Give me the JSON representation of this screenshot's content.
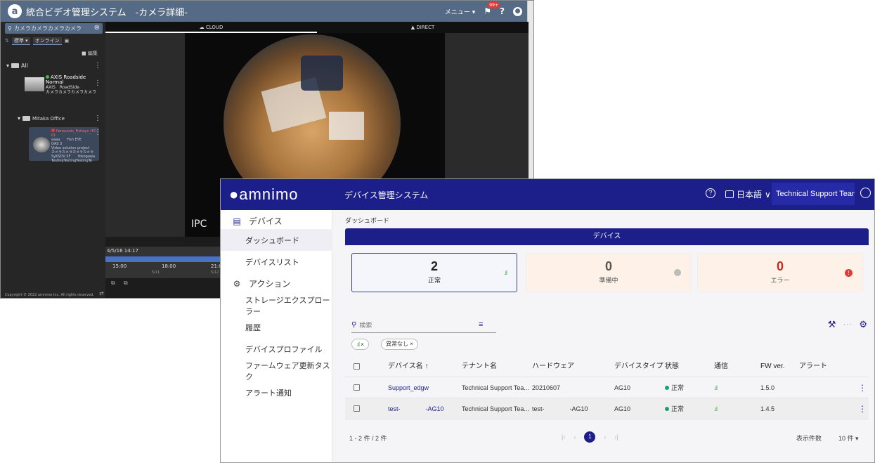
{
  "vms": {
    "title": "統合ビデオ管理システム　-カメラ詳細-",
    "menu_label": "メニュー ▾",
    "badge": "99+",
    "search_placeholder": "カメラカメラカメラカメラ",
    "filter_sort": "標準",
    "filter_online": "オンライン",
    "edit_label": "編集",
    "folder_all": "All",
    "camera1": {
      "name": "AXIS Roadside Normal",
      "maker": "AXIS",
      "model": "RoadSide",
      "desc": "カメラカメラカメラカメラ"
    },
    "folder_office": "Mitaka Office",
    "camera2": {
      "name": "Panasonic_Fisheye_IPC-01",
      "line1": "aaaa　　Fish EYE",
      "line2": "OAS 3",
      "line3": "Video solution project",
      "line4": "カメラカメラカメラカメラ",
      "line5": "SyKSDV 5F　　Yokogawa",
      "line6": "TestingTestingTestingTe"
    },
    "copyright": "Copyright © 2022 amnimo Inc. All rights reserved.",
    "tabs": [
      "CLOUD",
      "DIRECT"
    ],
    "overlay": "IPC",
    "timeline": {
      "date": "4/5/16 14:17",
      "t1": "15:00",
      "t2": "18:00",
      "t3": "21:0",
      "d1": "5/11",
      "d2": "5/12"
    },
    "colors": {
      "header": "#556b85"
    }
  },
  "dm": {
    "brand": "amnimo",
    "system": "デバイス管理システム",
    "language": "日本語",
    "team": "Technical Support Team ...",
    "nav": {
      "devices": "デバイス",
      "dashboard": "ダッシュボード",
      "device_list": "デバイスリスト",
      "actions": "アクション",
      "storage": "ストレージエクスプローラー",
      "history": "履歴",
      "profile": "デバイスプロファイル",
      "firmware": "ファームウェア更新タスク",
      "alert": "アラート通知"
    },
    "breadcrumb": "ダッシュボード",
    "panel_title": "デバイス",
    "cards": {
      "ok": {
        "count": "2",
        "label": "正常"
      },
      "prep": {
        "count": "0",
        "label": "準備中"
      },
      "err": {
        "count": "0",
        "label": "エラー"
      }
    },
    "search_placeholder": "検索",
    "chips": {
      "c1": "×",
      "c2": "異常なし ×"
    },
    "columns": {
      "name": "デバイス名 ↑",
      "tenant": "テナント名",
      "hw": "ハードウェア",
      "type": "デバイスタイプ",
      "state": "状態",
      "comm": "通信",
      "fw": "FW ver.",
      "alert": "アラート"
    },
    "rows": [
      {
        "name": "Support_edgw",
        "tenant": "Technical Support Tea...",
        "hw": "20210607",
        "type": "AG10",
        "state": "正常",
        "fw": "1.5.0"
      },
      {
        "name": "test-　　　　-AG10",
        "tenant": "Technical Support Tea...",
        "hw": "test-　　　　-AG10",
        "type": "AG10",
        "state": "正常",
        "fw": "1.4.5"
      }
    ],
    "footer": {
      "count": "1 - 2 件 / 2 件",
      "page": "1",
      "per_page_label": "表示件数",
      "per_page": "10 件 ▾"
    },
    "colors": {
      "primary": "#1c1f8a",
      "ok": "#1d9e7a",
      "error": "#e53935"
    }
  }
}
